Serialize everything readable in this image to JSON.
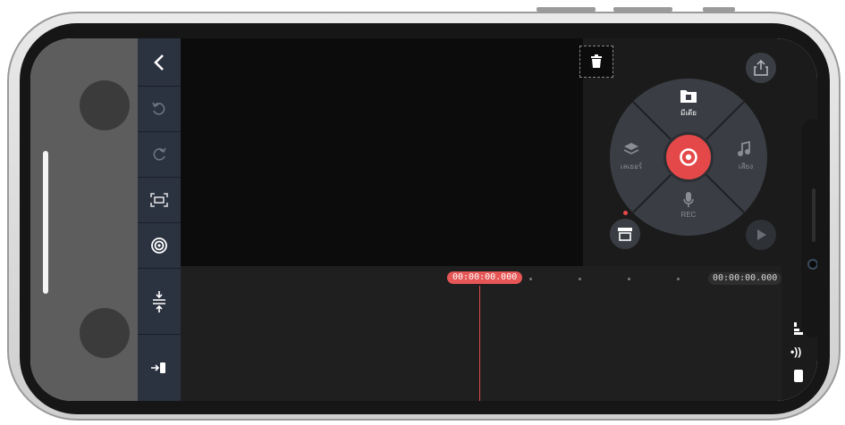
{
  "toolbar": {
    "items": [
      {
        "name": "back-icon"
      },
      {
        "name": "undo-icon"
      },
      {
        "name": "redo-icon"
      },
      {
        "name": "fit-screen-icon"
      },
      {
        "name": "target-icon"
      },
      {
        "name": "adjust-height-icon"
      },
      {
        "name": "jump-to-end-icon"
      }
    ]
  },
  "timeline": {
    "current_time": "00:00:00.000",
    "total_time": "00:00:00.000"
  },
  "panel": {
    "media_label": "มีเดีย",
    "layer_label": "เลเยอร์",
    "audio_label": "เสียง",
    "rec_label": "REC"
  },
  "status": {
    "indicator": "•))"
  },
  "colors": {
    "accent_red": "#e54848",
    "toolbar_bg": "#2b3240",
    "preview_bg": "#0c0c0c",
    "dial_bg": "#3a3e44"
  }
}
